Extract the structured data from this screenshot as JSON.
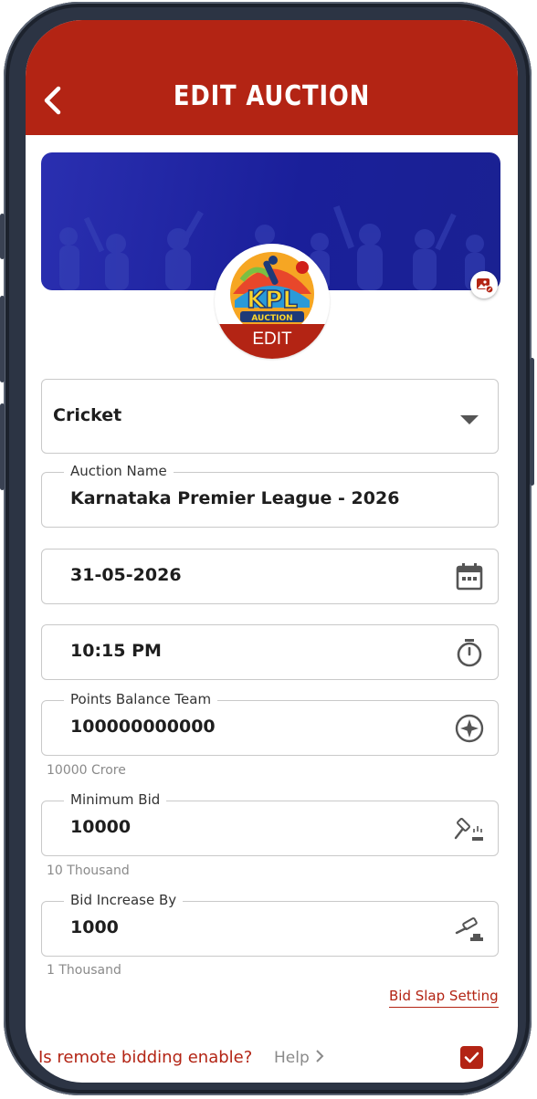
{
  "header": {
    "title": "EDIT AUCTION",
    "back_icon": "chevron-left-icon",
    "color": "#b32414"
  },
  "banner": {
    "edit_icon": "image-edit-icon"
  },
  "logo": {
    "text": "KPL",
    "subtext": "AUCTION",
    "edit_label": "EDIT"
  },
  "fields": {
    "sport": {
      "value": "Cricket",
      "icon": "caret-down-icon"
    },
    "auction_name": {
      "label": "Auction Name",
      "value": "Karnataka Premier League - 2026"
    },
    "date": {
      "value": "31-05-2026",
      "icon": "calendar-icon"
    },
    "time": {
      "value": "10:15 PM",
      "icon": "timer-icon"
    },
    "points_balance": {
      "label": "Points Balance Team",
      "value": "100000000000",
      "helper": "10000 Crore",
      "icon": "compass-icon"
    },
    "minimum_bid": {
      "label": "Minimum Bid",
      "value": "10000",
      "helper": "10 Thousand",
      "icon": "gavel-icon"
    },
    "bid_increase": {
      "label": "Bid Increase By",
      "value": "1000",
      "helper": "1 Thousand",
      "icon": "gavel-icon"
    }
  },
  "bid_slap_link": "Bid Slap Setting",
  "remote_bidding": {
    "label": "Is remote bidding enable?",
    "help": "Help",
    "checked": true
  }
}
